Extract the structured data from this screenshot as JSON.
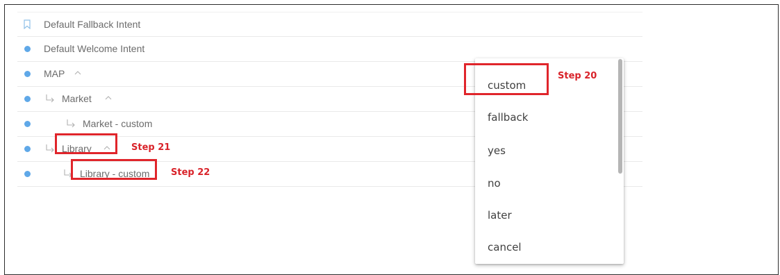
{
  "intents": [
    {
      "label": "Default Fallback Intent"
    },
    {
      "label": "Default Welcome Intent"
    },
    {
      "label": "MAP"
    },
    {
      "label": "Market"
    },
    {
      "label": "Market - custom"
    },
    {
      "label": "Library"
    },
    {
      "label": "Library - custom"
    }
  ],
  "menu": {
    "options": [
      "custom",
      "fallback",
      "yes",
      "no",
      "later",
      "cancel"
    ]
  },
  "annotations": {
    "step20": "Step 20",
    "step21": "Step 21",
    "step22": "Step 22"
  },
  "colors": {
    "accent_dot": "#5fa8e8",
    "highlight_red": "#e0252b",
    "step_text": "#d9232a"
  },
  "icons": {
    "bookmark": "bookmark-icon",
    "dot": "intent-dot-icon",
    "followup": "followup-arrow-icon",
    "collapse": "chevron-up-icon"
  }
}
